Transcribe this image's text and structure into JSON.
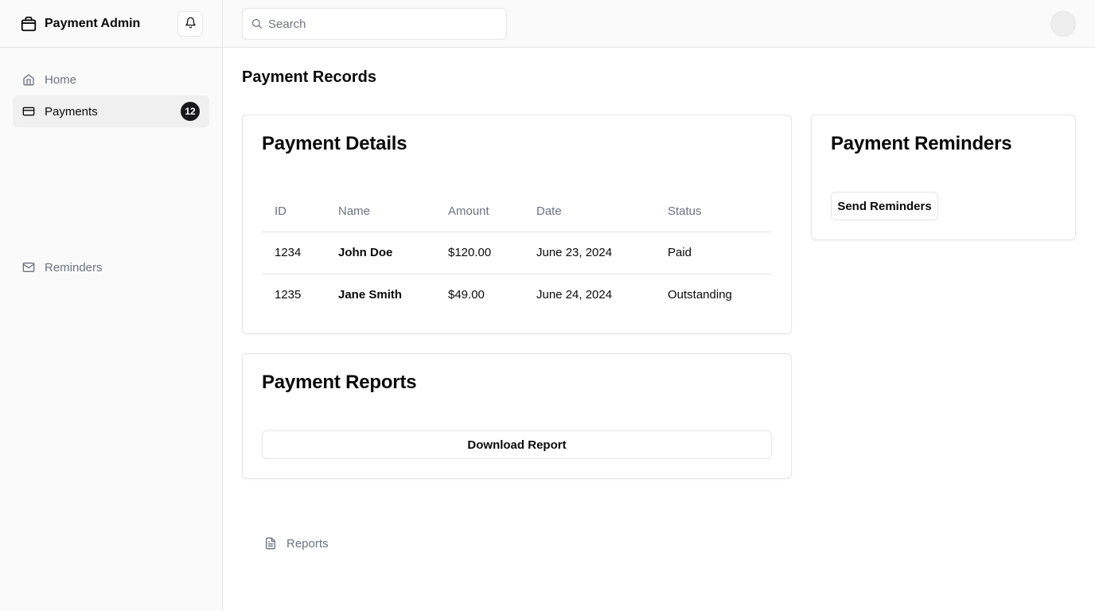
{
  "app": {
    "name": "Payment Admin"
  },
  "sidebar": {
    "items": [
      {
        "label": "Home",
        "icon": "home-icon"
      },
      {
        "label": "Payments",
        "icon": "credit-card-icon",
        "badge": "12",
        "active": true
      },
      {
        "label": "Reports",
        "icon": "file-text-icon"
      },
      {
        "label": "Reminders",
        "icon": "mail-icon"
      }
    ]
  },
  "topbar": {
    "search_placeholder": "Search"
  },
  "page": {
    "title": "Payment Records"
  },
  "details": {
    "title": "Payment Details",
    "columns": [
      "ID",
      "Name",
      "Amount",
      "Date",
      "Status"
    ],
    "rows": [
      {
        "id": "1234",
        "name": "John Doe",
        "amount": "$120.00",
        "date": "June 23, 2024",
        "status": "Paid"
      },
      {
        "id": "1235",
        "name": "Jane Smith",
        "amount": "$49.00",
        "date": "June 24, 2024",
        "status": "Outstanding"
      }
    ]
  },
  "reports": {
    "title": "Payment Reports",
    "button": "Download Report"
  },
  "reminders": {
    "title": "Payment Reminders",
    "button": "Send Reminders"
  },
  "colors": {
    "sidebar_bg": "#fafafa",
    "border": "#e5e5e5",
    "muted_text": "#6b7280",
    "badge_bg": "#18181b",
    "active_bg": "#f0f0f0"
  }
}
